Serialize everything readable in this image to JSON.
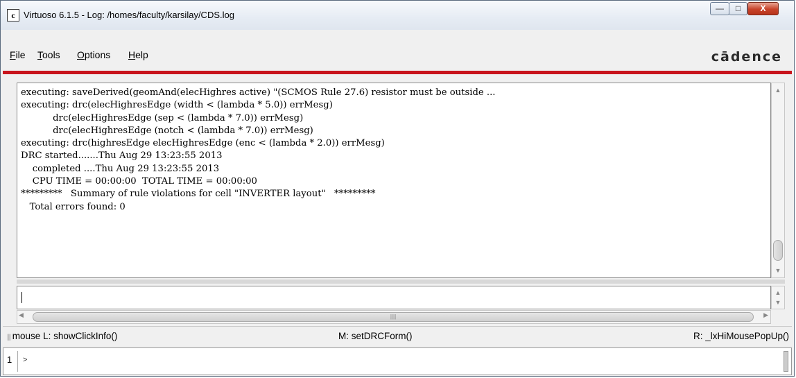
{
  "window": {
    "title": "Virtuoso 6.1.5 - Log: /homes/faculty/karsilay/CDS.log",
    "icon_label": "c",
    "minimize_glyph": "—",
    "maximize_glyph": "□",
    "close_glyph": "X"
  },
  "menubar": {
    "items": [
      {
        "first": "F",
        "rest": "ile"
      },
      {
        "first": "T",
        "rest": "ools"
      },
      {
        "first": "O",
        "rest": "ptions"
      },
      {
        "first": "H",
        "rest": "elp"
      }
    ],
    "brand": "cādence",
    "accent_color": "#c8141c"
  },
  "log": {
    "lines": [
      "executing: saveDerived(geomAnd(elecHighres active) \"(SCMOS Rule 27.6) resistor must be outside ...",
      "executing: drc(elecHighresEdge (width < (lambda * 5.0)) errMesg)",
      "           drc(elecHighresEdge (sep < (lambda * 7.0)) errMesg)",
      "           drc(elecHighresEdge (notch < (lambda * 7.0)) errMesg)",
      "executing: drc(highresEdge elecHighresEdge (enc < (lambda * 2.0)) errMesg)",
      "DRC started.......Thu Aug 29 13:23:55 2013",
      "    completed ....Thu Aug 29 13:23:55 2013",
      "    CPU TIME = 00:00:00  TOTAL TIME = 00:00:00",
      "*********   Summary of rule violations for cell \"INVERTER layout\"   *********",
      "   Total errors found: 0"
    ]
  },
  "input": {
    "value": ""
  },
  "status": {
    "left": "mouse L: showClickInfo()",
    "middle": "M: setDRCForm()",
    "right": "R: _lxHiMousePopUp()"
  },
  "cmdline": {
    "number": "1",
    "prompt": ">"
  }
}
